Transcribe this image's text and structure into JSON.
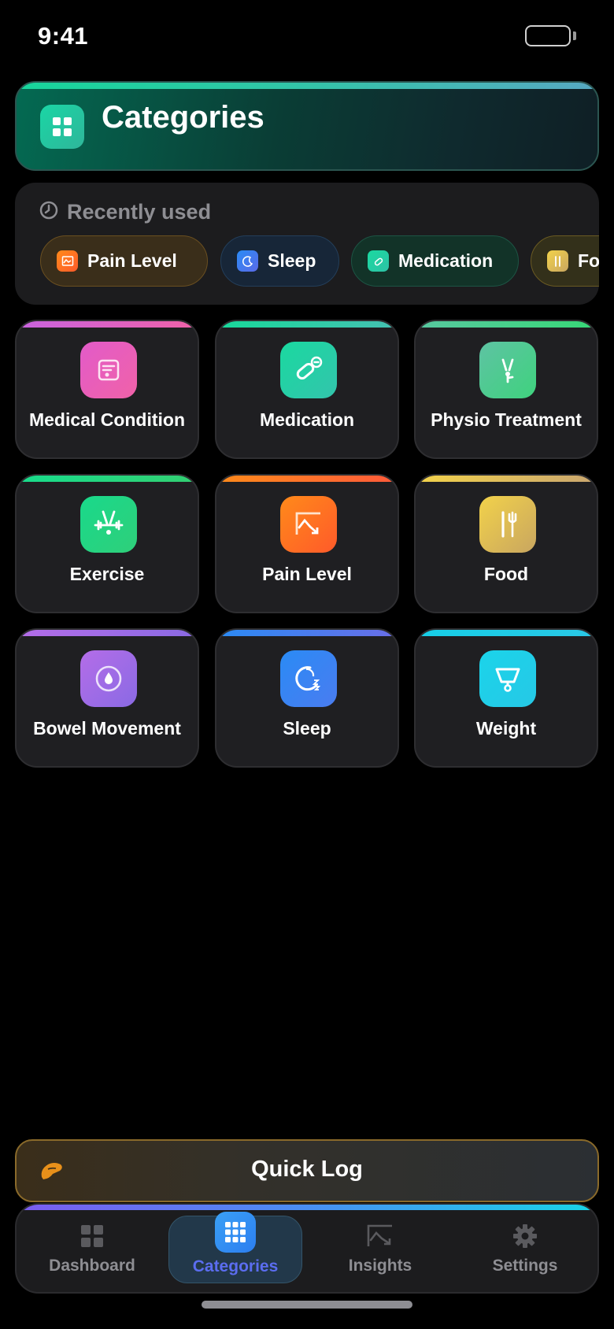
{
  "status": {
    "time": "9:41"
  },
  "header": {
    "title": "Categories",
    "icon": "grid-icon"
  },
  "recent": {
    "title": "Recently used",
    "icon": "clock-icon",
    "chips": [
      {
        "label": "Pain Level",
        "icon": "pain-chart-icon"
      },
      {
        "label": "Sleep",
        "icon": "moon-icon"
      },
      {
        "label": "Medication",
        "icon": "pill-icon"
      },
      {
        "label": "Food",
        "icon": "fork-knife-icon"
      }
    ]
  },
  "categories": [
    {
      "label": "Medical Condition",
      "icon": "clipboard-icon",
      "colors": [
        "#e25bc9",
        "#f062a8"
      ]
    },
    {
      "label": "Medication",
      "icon": "pill-icon",
      "colors": [
        "#1ad9a0",
        "#2ec2a6"
      ]
    },
    {
      "label": "Physio Treatment",
      "icon": "stretch-icon",
      "colors": [
        "#58c7a0",
        "#3bd27f"
      ]
    },
    {
      "label": "Exercise",
      "icon": "dumbbell-icon",
      "colors": [
        "#19d98b",
        "#2fcf7a"
      ]
    },
    {
      "label": "Pain Level",
      "icon": "pain-chart-icon",
      "colors": [
        "#ff8a1a",
        "#ff6a3a"
      ]
    },
    {
      "label": "Food",
      "icon": "fork-knife-icon",
      "colors": [
        "#f2d24a",
        "#c9a660"
      ]
    },
    {
      "label": "Bowel Movement",
      "icon": "drop-icon",
      "colors": [
        "#b46de8",
        "#8a6ae4"
      ]
    },
    {
      "label": "Sleep",
      "icon": "moon-icon",
      "colors": [
        "#2a8bf5",
        "#6a6ee8"
      ]
    },
    {
      "label": "Weight",
      "icon": "scale-icon",
      "colors": [
        "#1bd4ea",
        "#26c8e6"
      ]
    }
  ],
  "quicklog": {
    "label": "Quick Log",
    "icon": "hand-icon"
  },
  "tabs": [
    {
      "label": "Dashboard",
      "icon": "dashboard-icon"
    },
    {
      "label": "Categories",
      "icon": "grid-icon"
    },
    {
      "label": "Insights",
      "icon": "chart-icon"
    },
    {
      "label": "Settings",
      "icon": "gear-icon"
    }
  ]
}
